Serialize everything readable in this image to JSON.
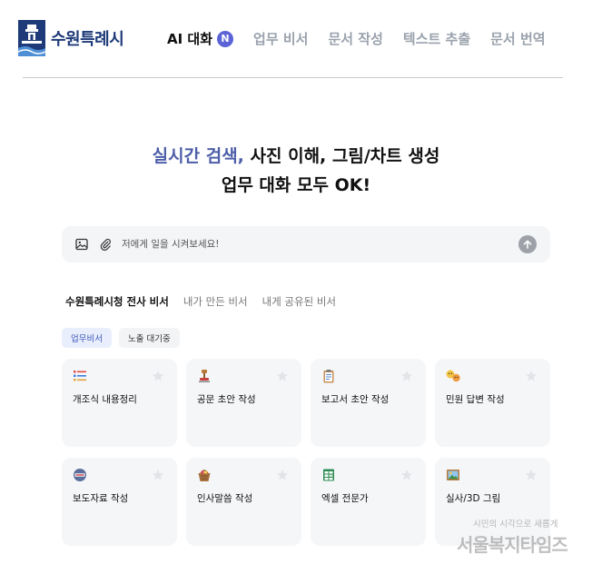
{
  "header": {
    "logo_text": "수원특례시",
    "nav": [
      {
        "label": "AI 대화",
        "badge": "N"
      },
      {
        "label": "업무 비서"
      },
      {
        "label": "문서 작성"
      },
      {
        "label": "텍스트 추출"
      },
      {
        "label": "문서 번역"
      }
    ]
  },
  "hero": {
    "accent": "실시간 검색,",
    "line1_rest": " 사진 이해, 그림/차트 생성",
    "line2": "업무 대화 모두 OK!"
  },
  "chat": {
    "placeholder": "저에게 일을 시켜보세요!"
  },
  "tabs": [
    "수원특례시청 전사 비서",
    "내가 만든 비서",
    "내게 공유된 비서"
  ],
  "chips": [
    "업무비서",
    "노출 대기중"
  ],
  "cards": [
    {
      "title": "개조식 내용정리",
      "icon": "list-emoji-icon"
    },
    {
      "title": "공문 초안 작성",
      "icon": "stamp-emoji-icon"
    },
    {
      "title": "보고서 초안 작성",
      "icon": "clipboard-emoji-icon"
    },
    {
      "title": "민원 답변 작성",
      "icon": "faces-emoji-icon"
    },
    {
      "title": "보도자료 작성",
      "icon": "news-emoji-icon"
    },
    {
      "title": "인사말씀 작성",
      "icon": "basket-emoji-icon"
    },
    {
      "title": "엑셀 전문가",
      "icon": "spreadsheet-emoji-icon"
    },
    {
      "title": "실사/3D 그림",
      "icon": "picture-emoji-icon"
    }
  ],
  "watermark": {
    "small": "시민의 시각으로 새롭게",
    "big": "서울복지타임즈"
  },
  "colors": {
    "accent": "#4d5ea8",
    "badge": "#5b63d6",
    "logo": "#1e3a78",
    "card_bg": "#f5f6f8"
  }
}
